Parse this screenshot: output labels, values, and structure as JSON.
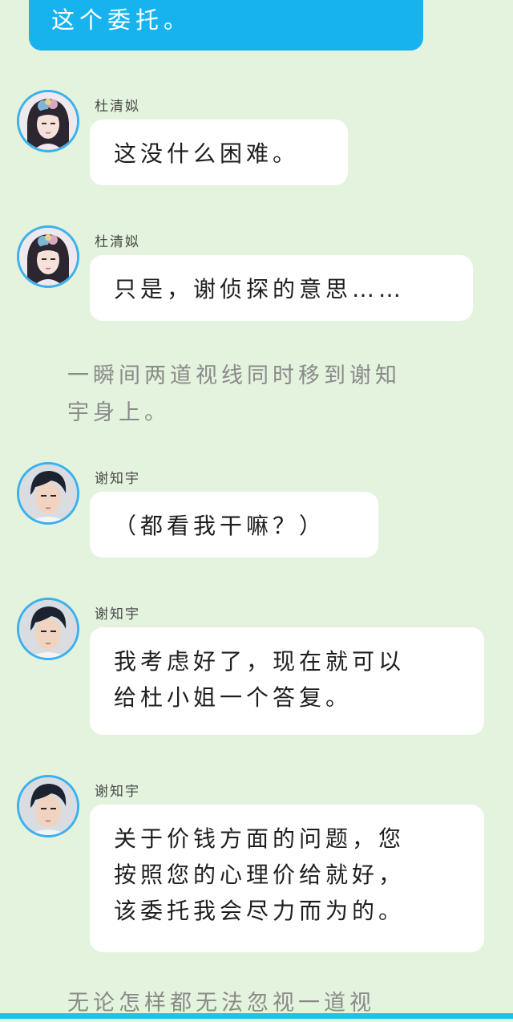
{
  "top_bubble": {
    "text": "这个委托。"
  },
  "messages": [
    {
      "name": "杜清姒",
      "text": "这没什么困难。",
      "avatar": "female-avatar-icon"
    },
    {
      "name": "杜清姒",
      "text": "只是，谢侦探的意思……",
      "avatar": "female-avatar-icon"
    },
    {
      "name": "谢知宇",
      "text": "（都看我干嘛？）",
      "avatar": "male-avatar-icon"
    },
    {
      "name": "谢知宇",
      "lines": [
        "我考虑好了，现在就可以",
        "给杜小姐一个答复。"
      ],
      "avatar": "male-avatar-icon"
    },
    {
      "name": "谢知宇",
      "lines": [
        "关于价钱方面的问题，您",
        "按照您的心理价给就好，",
        "该委托我会尽力而为的。"
      ],
      "avatar": "male-avatar-icon"
    }
  ],
  "narration": {
    "line1": [
      "一瞬间两道视线同时移到谢知",
      "宇身上。"
    ],
    "line2": "无论怎样都无法忽视一道视"
  },
  "colors": {
    "background": "#e3f3dd",
    "accent_bubble": "#16b3ef",
    "avatar_ring": "#3ab0ee",
    "bottom_bar": "#1ec2ea"
  }
}
